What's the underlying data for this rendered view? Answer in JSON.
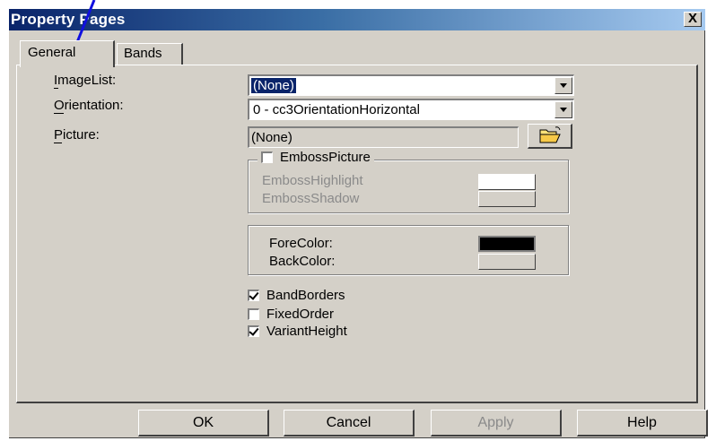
{
  "window": {
    "title": "Property Pages",
    "close_label": "X"
  },
  "tabs": [
    {
      "label": "General",
      "selected": true
    },
    {
      "label": "Bands",
      "selected": false
    }
  ],
  "fields": {
    "imagelist_label": "ImageList:",
    "imagelist_value": "(None)",
    "orientation_label": "Orientation:",
    "orientation_value": "0 - cc3OrientationHorizontal",
    "picture_label": "Picture:",
    "picture_value": "(None)"
  },
  "emboss_group": {
    "title": "EmbossPicture",
    "checked": false,
    "highlight_label": "EmbossHighlight",
    "shadow_label": "EmbossShadow"
  },
  "color_group": {
    "forecolor_label": "ForeColor:",
    "backcolor_label": "BackColor:",
    "forecolor": "#000000",
    "backcolor": "#d4d0c8"
  },
  "checkboxes": [
    {
      "label": "BandBorders",
      "checked": true
    },
    {
      "label": "FixedOrder",
      "checked": false
    },
    {
      "label": "VariantHeight",
      "checked": true
    }
  ],
  "buttons": {
    "ok": "OK",
    "cancel": "Cancel",
    "apply": "Apply",
    "help": "Help"
  },
  "colors": {
    "title_bar": "#0a246a",
    "face": "#d4d0c8",
    "selection": "#0a246a",
    "annotation_line": "#1010e0"
  }
}
